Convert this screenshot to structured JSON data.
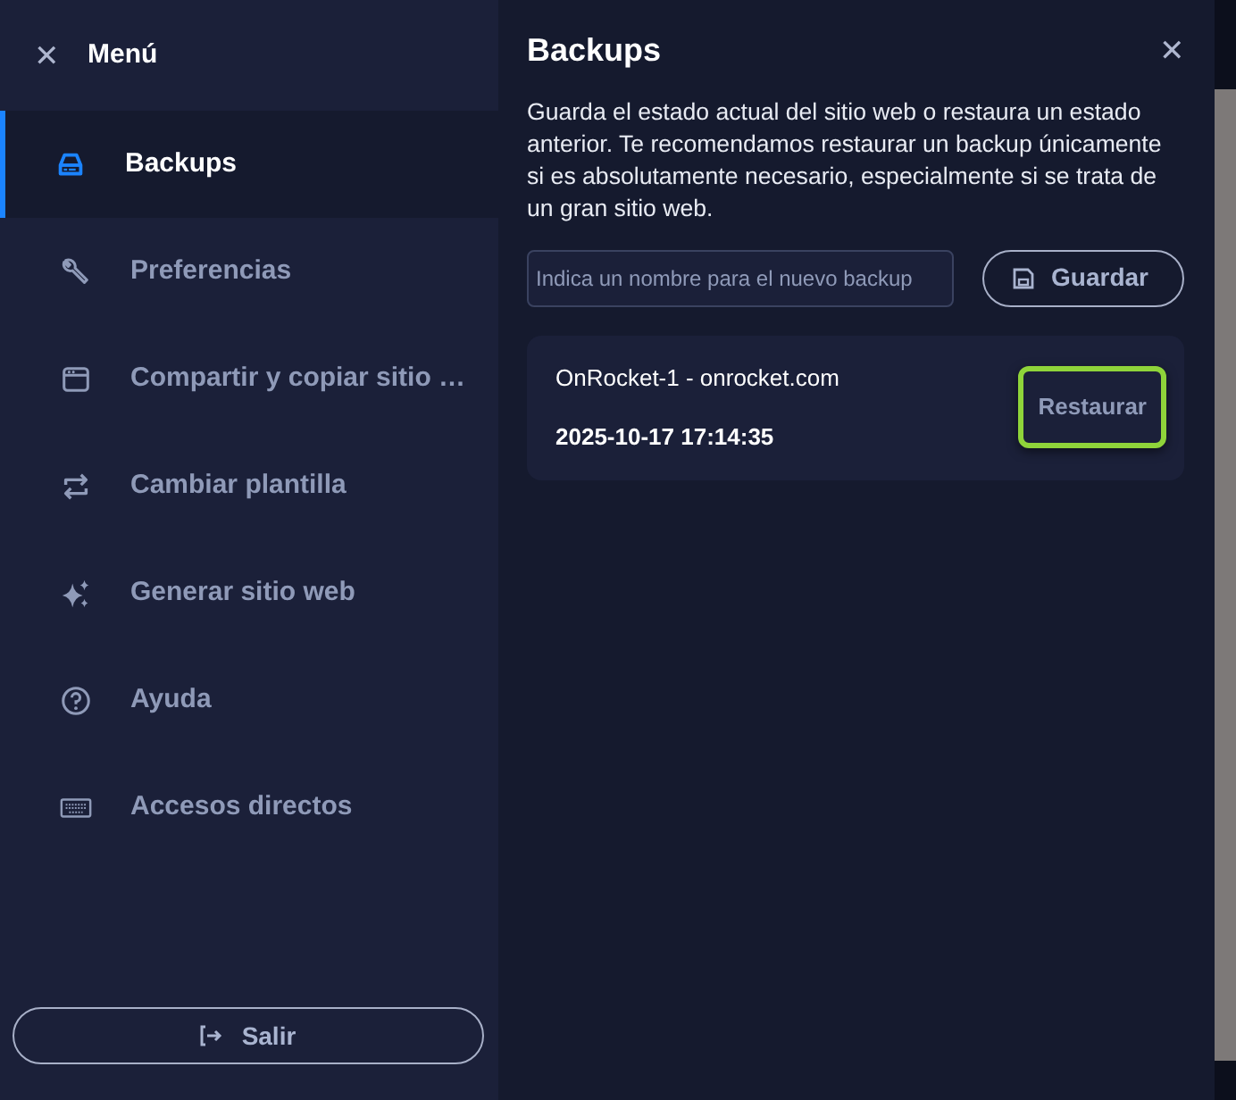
{
  "sidebar": {
    "close_icon": "✕",
    "title": "Menú",
    "items": [
      {
        "label": "Backups",
        "selected": true
      },
      {
        "label": "Preferencias",
        "selected": false
      },
      {
        "label": "Compartir y copiar sitio …",
        "selected": false
      },
      {
        "label": "Cambiar plantilla",
        "selected": false
      },
      {
        "label": "Generar sitio web",
        "selected": false
      },
      {
        "label": "Ayuda",
        "selected": false
      },
      {
        "label": "Accesos directos",
        "selected": false
      }
    ],
    "logout_button": "Salir"
  },
  "panel": {
    "title": "Backups",
    "close_icon": "✕",
    "description": "Guarda el estado actual del sitio web o restaura un estado anterior. Te recomendamos restaurar un backup únicamente si es absolutamente necesario, especialmente si se trata de un gran sitio web.",
    "name_field": {
      "placeholder": "Indica un nombre para el nuevo backup"
    },
    "save_button": "Guardar",
    "backups": [
      {
        "name": "OnRocket-1 - onrocket.com",
        "date": "2025-10-17 17:14:35",
        "restore_button": "Restaurar",
        "highlighted": true
      }
    ]
  }
}
